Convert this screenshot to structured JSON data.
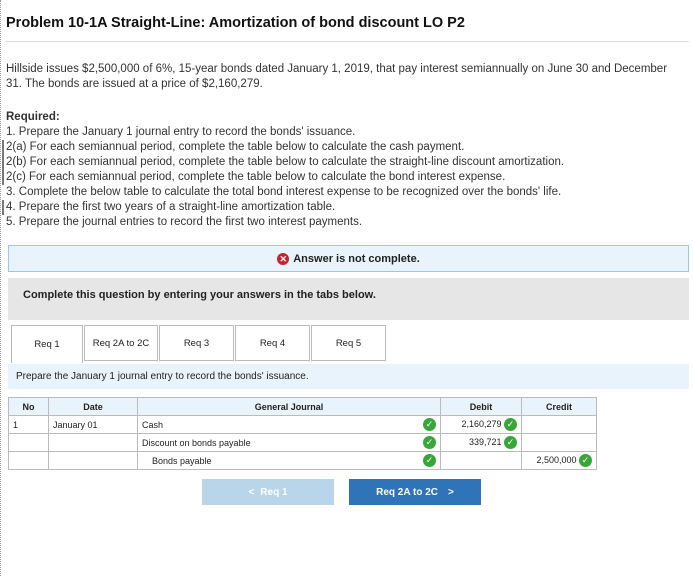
{
  "title": "Problem 10-1A Straight-Line: Amortization of bond discount LO P2",
  "intro": "Hillside issues $2,500,000 of 6%, 15-year bonds dated January 1, 2019, that pay interest semiannually on June 30 and December 31. The bonds are issued at a price of $2,160,279.",
  "required_label": "Required:",
  "requirements": [
    "1. Prepare the January 1 journal entry to record the bonds' issuance.",
    "2(a) For each semiannual period, complete the table below to calculate the cash payment.",
    "2(b) For each semiannual period, complete the table below to calculate the straight-line discount amortization.",
    "2(c) For each semiannual period, complete the table below to calculate the bond interest expense.",
    "3. Complete the below table to calculate the total bond interest expense to be recognized over the bonds' life.",
    "4. Prepare the first two years of a straight-line amortization table.",
    "5. Prepare the journal entries to record the first two interest payments."
  ],
  "banner": {
    "text": "Answer is not complete.",
    "icon": "x-circle-icon"
  },
  "instruction": "Complete this question by entering your answers in the tabs below.",
  "tabs": [
    "Req 1",
    "Req 2A to 2C",
    "Req 3",
    "Req 4",
    "Req 5"
  ],
  "active_tab": 0,
  "prompt": "Prepare the January 1 journal entry to record the bonds' issuance.",
  "journal": {
    "headers": {
      "no": "No",
      "date": "Date",
      "general_journal": "General Journal",
      "debit": "Debit",
      "credit": "Credit"
    },
    "rows": [
      {
        "no": "1",
        "date": "January 01",
        "account": "Cash",
        "debit": "2,160,279",
        "credit": ""
      },
      {
        "no": "",
        "date": "",
        "account": "Discount on bonds payable",
        "debit": "339,721",
        "credit": ""
      },
      {
        "no": "",
        "date": "",
        "account": "Bonds payable",
        "debit": "",
        "credit": "2,500,000"
      }
    ]
  },
  "buttons": {
    "prev": "Req 1",
    "next": "Req 2A to 2C"
  },
  "colors": {
    "accent": "#2f73b9",
    "check": "#3aa63a",
    "error": "#c8232c",
    "banner_bg": "#e9f3fb"
  }
}
